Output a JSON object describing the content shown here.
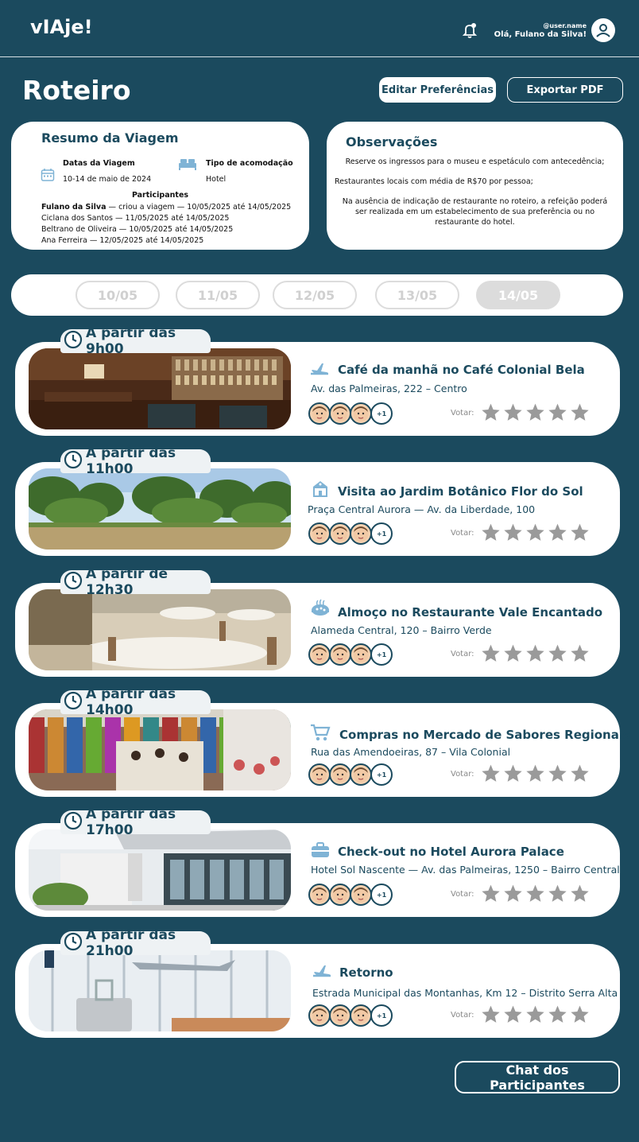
{
  "header": {
    "logo": "vIAje!",
    "username": "@user.name",
    "greeting": "Olá, Fulano da Silva!"
  },
  "page": {
    "title": "Roteiro",
    "edit_prefs_label": "Editar Preferências",
    "export_pdf_label": "Exportar PDF",
    "chat_label": "Chat dos Participantes"
  },
  "resumo": {
    "title": "Resumo da Viagem",
    "dates_label": "Datas da Viagem",
    "dates_value": "10-14 de maio de 2024",
    "accommodation_label": "Tipo de acomodação",
    "accommodation_value": "Hotel",
    "participants_label": "Participantes",
    "participants": [
      {
        "name": "Fulano da Silva",
        "detail": " — criou a viagem — 10/05/2025 até 14/05/2025"
      },
      {
        "name": "",
        "detail": "Ciclana dos Santos — 11/05/2025 até 14/05/2025"
      },
      {
        "name": "",
        "detail": "Beltrano de Oliveira — 10/05/2025 até 14/05/2025"
      },
      {
        "name": "",
        "detail": "Ana Ferreira — 12/05/2025 até 14/05/2025"
      }
    ]
  },
  "observacoes": {
    "title": "Observações",
    "notes": [
      "Reserve os ingressos para o museu e espetáculo com antecedência;",
      "Restaurantes locais com média de R$70 por pessoa;",
      "Na ausência de indicação de restaurante no roteiro, a refeição poderá ser realizada em um estabelecimento de sua preferência ou no restaurante do hotel."
    ]
  },
  "dates": {
    "tabs": [
      "10/05",
      "11/05",
      "12/05",
      "13/05",
      "14/05"
    ],
    "active_index": 4
  },
  "vote_label": "Votar:",
  "extra_participants": "+1",
  "activities": [
    {
      "time": "A partir das 9h00",
      "icon": "plane-icon",
      "title": "Café da manhã no Café Colonial Bela",
      "address": "Av. das Palmeiras, 222 – Centro",
      "photo": "cafe-photo"
    },
    {
      "time": "A partir das 11h00",
      "icon": "museum-icon",
      "title": "Visita ao Jardim Botânico Flor do Sol",
      "address": "Praça Central Aurora — Av. da Liberdade, 100",
      "photo": "garden-photo"
    },
    {
      "time": "A partir de 12h30",
      "icon": "food-icon",
      "title": "Almoço no Restaurante Vale Encantado",
      "address": "Alameda Central, 120 – Bairro Verde",
      "photo": "restaurant-photo"
    },
    {
      "time": "A partir das 14h00",
      "icon": "cart-icon",
      "title": "Compras no Mercado de Sabores Regionais",
      "address": "Rua das Amendoeiras, 87 – Vila Colonial",
      "photo": "market-photo"
    },
    {
      "time": "A partir das 17h00",
      "icon": "suitcase-icon",
      "title": "Check-out no Hotel Aurora Palace",
      "address": "Hotel Sol Nascente — Av. das Palmeiras, 1250 – Bairro Central",
      "photo": "hotel-photo"
    },
    {
      "time": "A partir das 21h00",
      "icon": "plane-icon",
      "title": "Retorno",
      "address": "Estrada Municipal das Montanhas, Km 12 – Distrito Serra Alta",
      "photo": "airport-photo"
    }
  ],
  "colors": {
    "background": "#1b4a5e",
    "card": "#ffffff",
    "star": "#9a9a9a",
    "accent_icon": "#7fb3d5"
  }
}
